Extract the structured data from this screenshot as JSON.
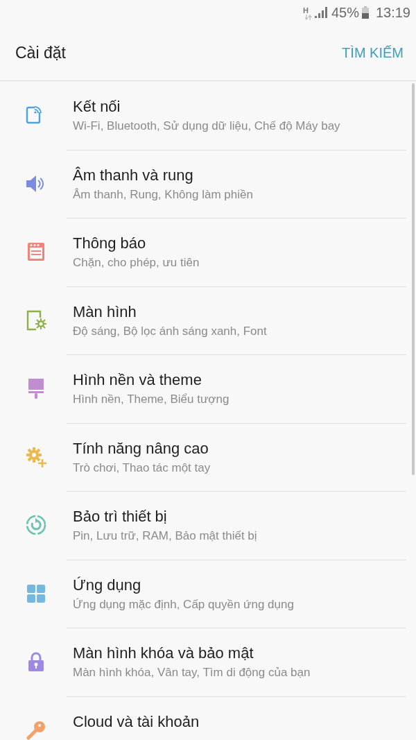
{
  "status_bar": {
    "network": "H",
    "battery": "45%",
    "time": "13:19"
  },
  "header": {
    "title": "Cài đặt",
    "search": "TÌM KIẾM"
  },
  "items": [
    {
      "title": "Kết nối",
      "subtitle": "Wi-Fi, Bluetooth, Sử dụng dữ liệu, Chế độ Máy bay",
      "color": "#4ea3d8"
    },
    {
      "title": "Âm thanh và rung",
      "subtitle": "Âm thanh, Rung, Không làm phiền",
      "color": "#7b8de0"
    },
    {
      "title": "Thông báo",
      "subtitle": "Chặn, cho phép, ưu tiên",
      "color": "#f0857a"
    },
    {
      "title": "Màn hình",
      "subtitle": "Độ sáng, Bộ lọc ánh sáng xanh, Font",
      "color": "#8db04a"
    },
    {
      "title": "Hình nền và theme",
      "subtitle": "Hình nền, Theme, Biểu tượng",
      "color": "#c08ed0"
    },
    {
      "title": "Tính năng nâng cao",
      "subtitle": "Trò chơi, Thao tác một tay",
      "color": "#ecb94e"
    },
    {
      "title": "Bảo trì thiết bị",
      "subtitle": "Pin, Lưu trữ, RAM, Bảo mật thiết bị",
      "color": "#6cc3b0"
    },
    {
      "title": "Ứng dụng",
      "subtitle": "Ứng dụng mặc định, Cấp quyền ứng dụng",
      "color": "#74b8e0"
    },
    {
      "title": "Màn hình khóa và bảo mật",
      "subtitle": "Màn hình khóa, Vân tay, Tìm di động của bạn",
      "color": "#9d8ae0"
    },
    {
      "title": "Cloud và tài khoản",
      "color": "#f4a06a"
    }
  ]
}
